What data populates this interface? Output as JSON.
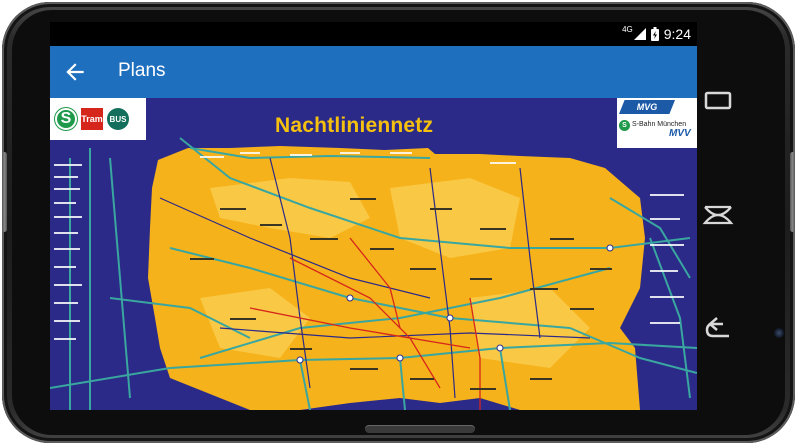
{
  "status_bar": {
    "network": "4G",
    "time": "9:24"
  },
  "app_bar": {
    "title": "Plans",
    "back_icon": "arrow-back-icon"
  },
  "map": {
    "title": "Nachtliniennetz",
    "logos": {
      "sbahn": "S",
      "tram": "Tram",
      "bus": "BUS",
      "mvg": "MVG",
      "sbahn_muenchen": "S-Bahn München",
      "mvv": "MVV"
    },
    "colors": {
      "background": "#2b2a88",
      "area": "#f6b21a",
      "line_teal": "#3aa6a0",
      "line_red": "#d6261c"
    }
  },
  "nav_bar": {
    "recents_icon": "recents-icon",
    "home_icon": "home-icon",
    "back_icon": "back-icon"
  },
  "colors": {
    "app_bar": "#1e6fbd",
    "phone_frame": "#1c1c1c"
  }
}
